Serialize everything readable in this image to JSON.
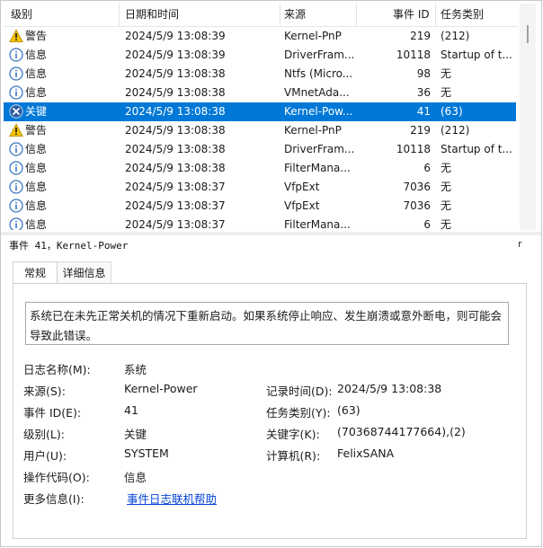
{
  "columns": [
    "级别",
    "日期和时间",
    "来源",
    "事件 ID",
    "任务类别"
  ],
  "rows": [
    {
      "icon": "warning",
      "level": "警告",
      "date": "2024/5/9 13:08:39",
      "source": "Kernel-PnP",
      "id": "219",
      "task": "(212)"
    },
    {
      "icon": "info",
      "level": "信息",
      "date": "2024/5/9 13:08:39",
      "source": "DriverFram...",
      "id": "10118",
      "task": "Startup of t..."
    },
    {
      "icon": "info",
      "level": "信息",
      "date": "2024/5/9 13:08:38",
      "source": "Ntfs (Micro...",
      "id": "98",
      "task": "无"
    },
    {
      "icon": "info",
      "level": "信息",
      "date": "2024/5/9 13:08:38",
      "source": "VMnetAda...",
      "id": "36",
      "task": "无"
    },
    {
      "icon": "critical",
      "level": "关键",
      "date": "2024/5/9 13:08:38",
      "source": "Kernel-Pow...",
      "id": "41",
      "task": "(63)",
      "selected": true
    },
    {
      "icon": "warning",
      "level": "警告",
      "date": "2024/5/9 13:08:38",
      "source": "Kernel-PnP",
      "id": "219",
      "task": "(212)"
    },
    {
      "icon": "info",
      "level": "信息",
      "date": "2024/5/9 13:08:38",
      "source": "DriverFram...",
      "id": "10118",
      "task": "Startup of t..."
    },
    {
      "icon": "info",
      "level": "信息",
      "date": "2024/5/9 13:08:38",
      "source": "FilterMana...",
      "id": "6",
      "task": "无"
    },
    {
      "icon": "info",
      "level": "信息",
      "date": "2024/5/9 13:08:37",
      "source": "VfpExt",
      "id": "7036",
      "task": "无"
    },
    {
      "icon": "info",
      "level": "信息",
      "date": "2024/5/9 13:08:37",
      "source": "VfpExt",
      "id": "7036",
      "task": "无"
    },
    {
      "icon": "info",
      "level": "信息",
      "date": "2024/5/9 13:08:37",
      "source": "FilterMana...",
      "id": "6",
      "task": "无"
    }
  ],
  "detail": {
    "title": "事件 41，Kernel-Power",
    "close": "r",
    "tabs": [
      "常规",
      "详细信息"
    ],
    "description": "系统已在未先正常关机的情况下重新启动。如果系统停止响应、发生崩溃或意外断电，则可能会导致此错误。",
    "labels": {
      "log_name": "日志名称(M):",
      "source": "来源(S):",
      "event_id": "事件 ID(E):",
      "level": "级别(L):",
      "user": "用户(U):",
      "opcode": "操作代码(O):",
      "more_info": "更多信息(I):",
      "logged": "记录时间(D):",
      "task_category": "任务类别(Y):",
      "keywords": "关键字(K):",
      "computer": "计算机(R):"
    },
    "values": {
      "log_name": "系统",
      "source": "Kernel-Power",
      "event_id": "41",
      "level": "关键",
      "user": "SYSTEM",
      "opcode": "信息",
      "more_info_link": "事件日志联机帮助",
      "logged": "2024/5/9 13:08:38",
      "task_category": "(63)",
      "keywords": "(70368744177664),(2)",
      "computer": "FelixSANA"
    }
  },
  "colors": {
    "selection": "#0078d7",
    "link": "#0645d6",
    "warning": "#f5c400",
    "info": "#3b78c2",
    "critical": "#2c5aa0"
  }
}
